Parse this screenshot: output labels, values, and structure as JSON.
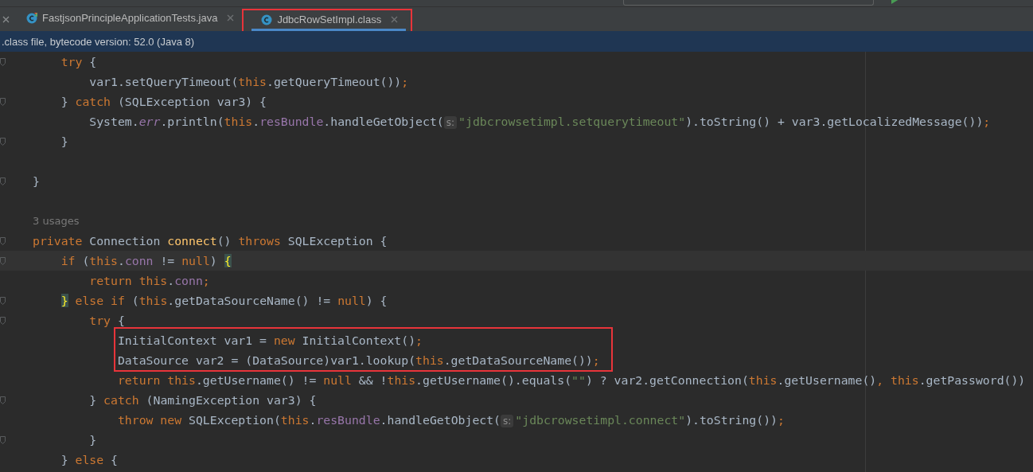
{
  "tabs": [
    {
      "label": "FastjsonPrincipleApplicationTests.java",
      "kind": "test",
      "selected": false,
      "annotated": false
    },
    {
      "label": "JdbcRowSetImpl.class",
      "kind": "class",
      "selected": true,
      "annotated": true
    }
  ],
  "info_bar": {
    "text": ".class file, bytecode version: 52.0 (Java 8)"
  },
  "code_lines": [
    {
      "kind": "code",
      "fold": true,
      "current": false,
      "boxed": false,
      "tokens": [
        {
          "text": "    try",
          "kind": "keyword"
        },
        {
          "text": " {",
          "kind": "plain"
        }
      ]
    },
    {
      "kind": "code",
      "fold": false,
      "current": false,
      "boxed": false,
      "tokens": [
        {
          "text": "        var1.setQueryTimeout(",
          "kind": "plain"
        },
        {
          "text": "this",
          "kind": "keyword"
        },
        {
          "text": ".getQueryTimeout())",
          "kind": "plain"
        },
        {
          "text": ";",
          "kind": "keyword"
        }
      ]
    },
    {
      "kind": "code",
      "fold": true,
      "current": false,
      "boxed": false,
      "tokens": [
        {
          "text": "    } ",
          "kind": "plain"
        },
        {
          "text": "catch",
          "kind": "keyword"
        },
        {
          "text": " (SQLException var3) {",
          "kind": "plain"
        }
      ]
    },
    {
      "kind": "code",
      "fold": false,
      "current": false,
      "boxed": false,
      "tokens": [
        {
          "text": "        System.",
          "kind": "plain"
        },
        {
          "text": "err",
          "kind": "static"
        },
        {
          "text": ".println(",
          "kind": "plain"
        },
        {
          "text": "this",
          "kind": "keyword"
        },
        {
          "text": ".",
          "kind": "plain"
        },
        {
          "text": "resBundle",
          "kind": "field"
        },
        {
          "text": ".handleGetObject(",
          "kind": "plain"
        },
        {
          "text": "s:",
          "kind": "hint"
        },
        {
          "text": "\"jdbcrowsetimpl.setquerytimeout\"",
          "kind": "string"
        },
        {
          "text": ").toString() + var3.getLocalizedMessage())",
          "kind": "plain"
        },
        {
          "text": ";",
          "kind": "keyword"
        }
      ]
    },
    {
      "kind": "code",
      "fold": true,
      "current": false,
      "boxed": false,
      "tokens": [
        {
          "text": "    }",
          "kind": "plain"
        }
      ]
    },
    {
      "kind": "blank"
    },
    {
      "kind": "code",
      "fold": true,
      "current": false,
      "boxed": false,
      "tokens": [
        {
          "text": "}",
          "kind": "plain"
        }
      ]
    },
    {
      "kind": "blank"
    },
    {
      "kind": "usages",
      "fold": false,
      "current": false,
      "boxed": false,
      "text": "3 usages"
    },
    {
      "kind": "code",
      "fold": true,
      "current": false,
      "boxed": false,
      "tokens": [
        {
          "text": "private",
          "kind": "keyword"
        },
        {
          "text": " Connection ",
          "kind": "plain"
        },
        {
          "text": "connect",
          "kind": "declaration"
        },
        {
          "text": "() ",
          "kind": "plain"
        },
        {
          "text": "throws",
          "kind": "keyword"
        },
        {
          "text": " SQLException {",
          "kind": "plain"
        }
      ]
    },
    {
      "kind": "code",
      "fold": true,
      "current": true,
      "boxed": false,
      "tokens": [
        {
          "text": "    if",
          "kind": "keyword"
        },
        {
          "text": " (",
          "kind": "plain"
        },
        {
          "text": "this",
          "kind": "keyword"
        },
        {
          "text": ".",
          "kind": "plain"
        },
        {
          "text": "conn",
          "kind": "field"
        },
        {
          "text": " != ",
          "kind": "plain"
        },
        {
          "text": "null",
          "kind": "keyword"
        },
        {
          "text": ") ",
          "kind": "plain"
        },
        {
          "text": "{",
          "kind": "brace-match"
        }
      ]
    },
    {
      "kind": "code",
      "fold": false,
      "current": false,
      "boxed": false,
      "tokens": [
        {
          "text": "        return this",
          "kind": "keyword"
        },
        {
          "text": ".",
          "kind": "plain"
        },
        {
          "text": "conn",
          "kind": "field"
        },
        {
          "text": ";",
          "kind": "keyword"
        }
      ]
    },
    {
      "kind": "code",
      "fold": true,
      "current": false,
      "boxed": false,
      "tokens": [
        {
          "text": "    }",
          "kind": "brace-match"
        },
        {
          "text": " else if",
          "kind": "keyword"
        },
        {
          "text": " (",
          "kind": "plain"
        },
        {
          "text": "this",
          "kind": "keyword"
        },
        {
          "text": ".getDataSourceName() != ",
          "kind": "plain"
        },
        {
          "text": "null",
          "kind": "keyword"
        },
        {
          "text": ") {",
          "kind": "plain"
        }
      ]
    },
    {
      "kind": "code",
      "fold": true,
      "current": false,
      "boxed": false,
      "tokens": [
        {
          "text": "        try",
          "kind": "keyword"
        },
        {
          "text": " {",
          "kind": "plain"
        }
      ]
    },
    {
      "kind": "code",
      "fold": false,
      "current": false,
      "boxed": true,
      "tokens": [
        {
          "text": "            InitialContext var1 = ",
          "kind": "plain"
        },
        {
          "text": "new",
          "kind": "keyword"
        },
        {
          "text": " InitialContext()",
          "kind": "plain"
        },
        {
          "text": ";",
          "kind": "keyword"
        }
      ]
    },
    {
      "kind": "code",
      "fold": false,
      "current": false,
      "boxed": true,
      "tokens": [
        {
          "text": "            DataSource var2 = (DataSource)var1.lookup(",
          "kind": "plain"
        },
        {
          "text": "this",
          "kind": "keyword"
        },
        {
          "text": ".getDataSourceName())",
          "kind": "plain"
        },
        {
          "text": ";",
          "kind": "keyword"
        }
      ]
    },
    {
      "kind": "code",
      "fold": false,
      "current": false,
      "boxed": false,
      "tokens": [
        {
          "text": "            return this",
          "kind": "keyword"
        },
        {
          "text": ".getUsername() != ",
          "kind": "plain"
        },
        {
          "text": "null",
          "kind": "keyword"
        },
        {
          "text": " && !",
          "kind": "plain"
        },
        {
          "text": "this",
          "kind": "keyword"
        },
        {
          "text": ".getUsername().equals(",
          "kind": "plain"
        },
        {
          "text": "\"\"",
          "kind": "string"
        },
        {
          "text": ") ? var2.getConnection(",
          "kind": "plain"
        },
        {
          "text": "this",
          "kind": "keyword"
        },
        {
          "text": ".getUsername()",
          "kind": "plain"
        },
        {
          "text": ", this",
          "kind": "keyword"
        },
        {
          "text": ".getPassword())",
          "kind": "plain"
        }
      ]
    },
    {
      "kind": "code",
      "fold": true,
      "current": false,
      "boxed": false,
      "tokens": [
        {
          "text": "        } ",
          "kind": "plain"
        },
        {
          "text": "catch",
          "kind": "keyword"
        },
        {
          "text": " (NamingException var3) {",
          "kind": "plain"
        }
      ]
    },
    {
      "kind": "code",
      "fold": false,
      "current": false,
      "boxed": false,
      "tokens": [
        {
          "text": "            throw new",
          "kind": "keyword"
        },
        {
          "text": " SQLException(",
          "kind": "plain"
        },
        {
          "text": "this",
          "kind": "keyword"
        },
        {
          "text": ".",
          "kind": "plain"
        },
        {
          "text": "resBundle",
          "kind": "field"
        },
        {
          "text": ".handleGetObject(",
          "kind": "plain"
        },
        {
          "text": "s:",
          "kind": "hint"
        },
        {
          "text": "\"jdbcrowsetimpl.connect\"",
          "kind": "string"
        },
        {
          "text": ").toString())",
          "kind": "plain"
        },
        {
          "text": ";",
          "kind": "keyword"
        }
      ]
    },
    {
      "kind": "code",
      "fold": true,
      "current": false,
      "boxed": false,
      "tokens": [
        {
          "text": "        }",
          "kind": "plain"
        }
      ]
    },
    {
      "kind": "code",
      "fold": false,
      "boxed": false,
      "tokens": [
        {
          "text": "    } ",
          "kind": "plain"
        },
        {
          "text": "else",
          "kind": "keyword"
        },
        {
          "text": " {",
          "kind": "plain"
        }
      ]
    }
  ]
}
